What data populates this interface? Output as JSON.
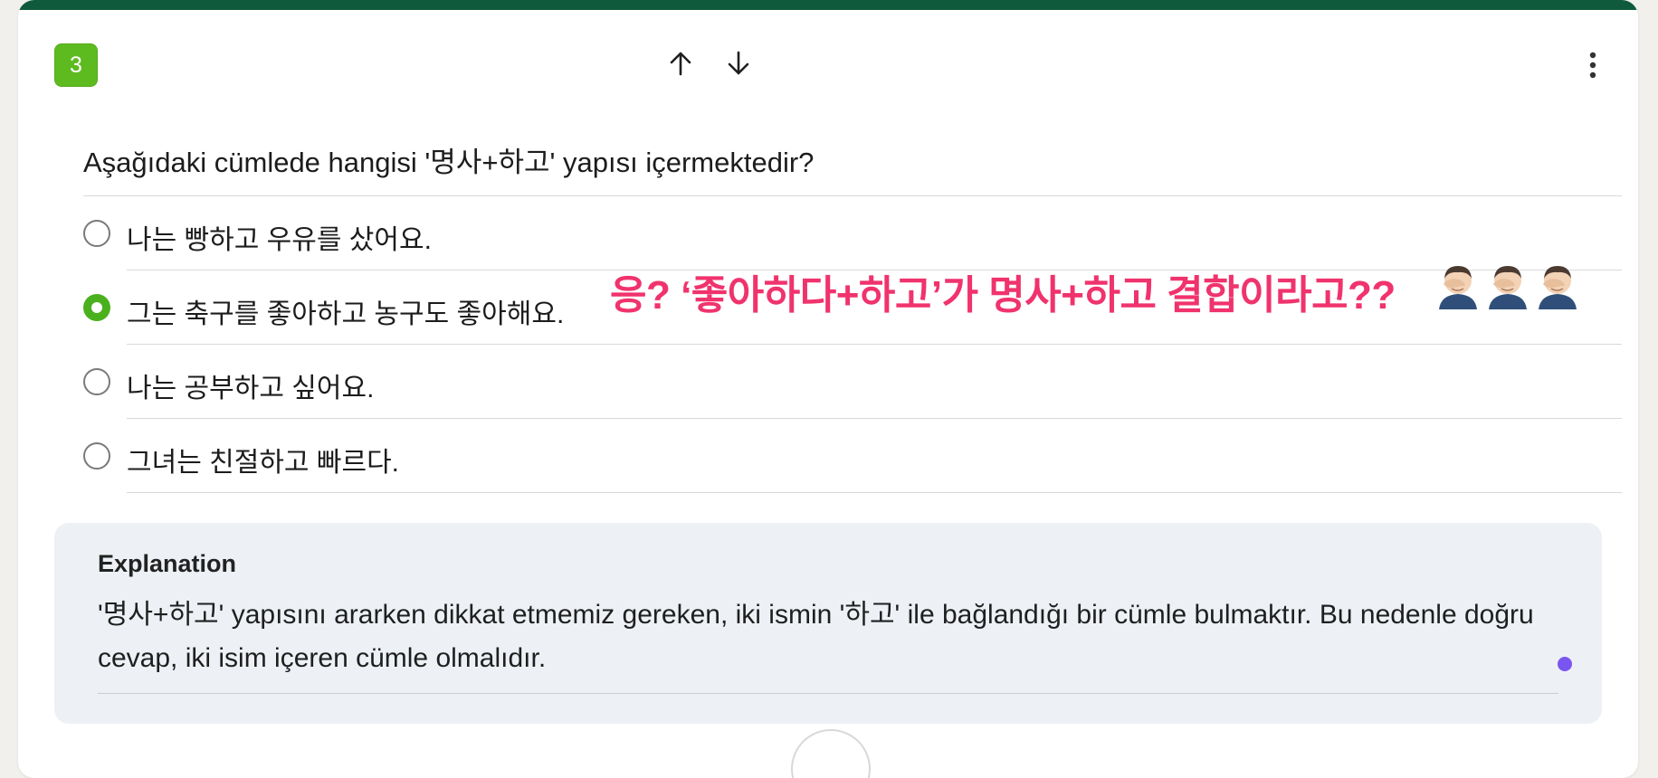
{
  "question": {
    "number": "3",
    "text": "Aşağıdaki cümlede hangisi '명사+하고' yapısı içermektedir?"
  },
  "toolbar": {
    "move_up_icon": "arrow-up-icon",
    "move_down_icon": "arrow-down-icon",
    "more_icon": "more-vertical-icon"
  },
  "options": [
    {
      "text": "나는 빵하고 우유를 샀어요.",
      "selected": false
    },
    {
      "text": "그는 축구를 좋아하고 농구도 좋아해요.",
      "selected": true
    },
    {
      "text": "나는 공부하고 싶어요.",
      "selected": false
    },
    {
      "text": "그녀는 친절하고 빠르다.",
      "selected": false
    }
  ],
  "annotation": {
    "text": "응? ‘좋아하다+하고’가 명사+하고 결합이라고??",
    "emoji": "facepalm-emoji",
    "emoji_count": 3,
    "color": "#f0336d"
  },
  "explanation": {
    "title": "Explanation",
    "text": "'명사+하고' yapısını ararken dikkat etmemiz gereken, iki ismin '하고' ile bağlandığı bir cümle bulmaktır. Bu nedenle doğru cevap, iki isim içeren cümle olmalıdır."
  },
  "colors": {
    "top_bar": "#0f5a3c",
    "badge": "#5ebb1f",
    "selected_radio": "#4ab01e",
    "explanation_bg": "#edf1f5",
    "dot": "#7b55f0"
  }
}
